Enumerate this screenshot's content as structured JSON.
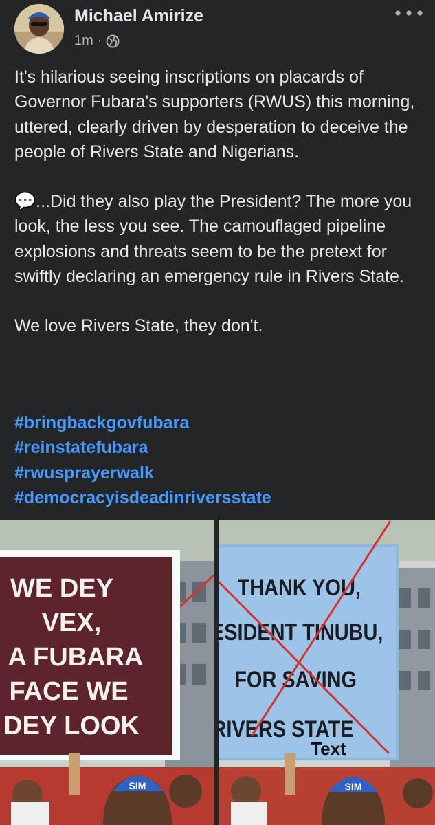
{
  "post": {
    "author": "Michael Amirize",
    "time": "1m",
    "separator": "·",
    "privacy_icon": "globe-icon",
    "more_icon": "more-dots-icon",
    "paragraphs": [
      "It's hilarious seeing inscriptions on placards of Governor Fubara's supporters (RWUS) this morning, uttered, clearly driven by desperation to deceive the people of Rivers State and Nigerians.",
      "💬...Did they also play the President? The more you look, the less you see. The camouflaged pipeline explosions and threats seem to be the pretext for swiftly declaring an emergency rule in Rivers State.",
      "We love Rivers State, they don't."
    ],
    "hashtags": [
      "#bringbackgovfubara",
      "#reinstatefubara",
      "#rwusprayerwalk",
      "#democracyisdeadinriversstate"
    ]
  },
  "photos": {
    "left": {
      "placard_lines": [
        "WE DEY",
        "VEX,",
        "A FUBARA",
        "FACE WE",
        "DEY LOOK"
      ],
      "cap_text": "SIM"
    },
    "right": {
      "placard_lines": [
        "THANK YOU,",
        "RESIDENT TINUBU,",
        "FOR SAVING",
        "RIVERS STATE"
      ],
      "overlay_text": "Text",
      "cap_text": "SIM"
    }
  },
  "colors": {
    "background": "#242526",
    "text": "#e4e6eb",
    "secondary": "#b0b3b8",
    "hashtag": "#4599ff",
    "cross_mark": "#d9302b"
  }
}
